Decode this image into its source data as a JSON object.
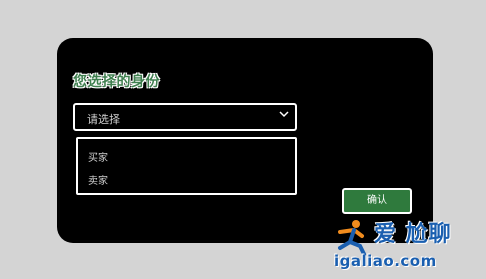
{
  "dialog": {
    "title": "您选择的身份",
    "select": {
      "value": "请选择"
    },
    "dropdown": {
      "options": [
        "买家",
        "卖家"
      ]
    },
    "confirm_label": "确认"
  },
  "watermark": {
    "brand_text": "爱 尬聊",
    "domain_text": "igaliao.com"
  },
  "colors": {
    "title_green": "#3f7f4f",
    "button_green": "#2f7a3d",
    "dialog_bg": "#000000",
    "page_bg": "#d4d4d4",
    "watermark_blue": "#1a5fb0",
    "watermark_orange": "#f08c1e"
  },
  "icons": {
    "select_arrow": "chevron-down-icon",
    "watermark_logo": "running-figure-icon"
  }
}
